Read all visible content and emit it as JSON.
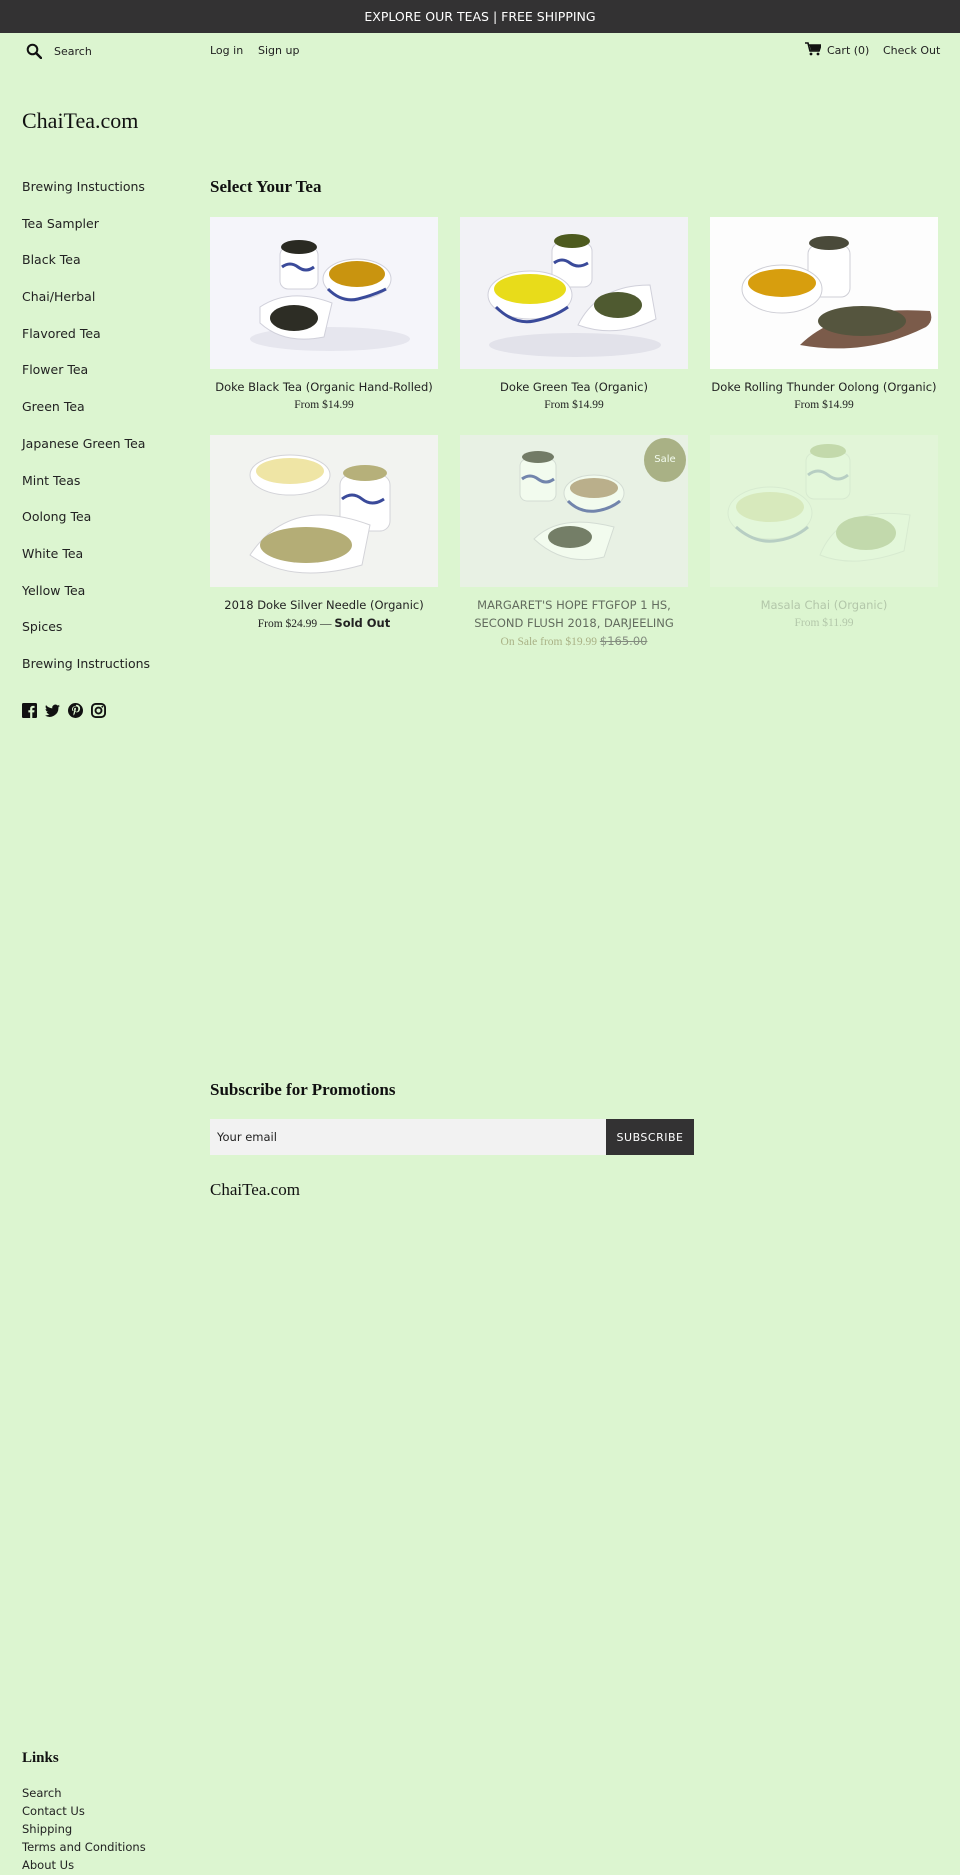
{
  "announcement": "EXPLORE OUR TEAS | FREE SHIPPING",
  "header": {
    "search_placeholder": "Search",
    "login": "Log in",
    "signup": "Sign up",
    "cart": "Cart (0)",
    "checkout": "Check Out"
  },
  "logo": "ChaiTea.com",
  "sidebar": {
    "items": [
      {
        "label": "Brewing Instuctions"
      },
      {
        "label": "Tea Sampler"
      },
      {
        "label": "Black Tea"
      },
      {
        "label": "Chai/Herbal"
      },
      {
        "label": "Flavored Tea"
      },
      {
        "label": "Flower Tea"
      },
      {
        "label": "Green Tea"
      },
      {
        "label": "Japanese Green Tea"
      },
      {
        "label": "Mint Teas"
      },
      {
        "label": "Oolong Tea"
      },
      {
        "label": "White Tea"
      },
      {
        "label": "Yellow Tea"
      },
      {
        "label": "Spices"
      },
      {
        "label": "Brewing Instructions"
      }
    ],
    "social_icons": [
      "facebook-icon",
      "twitter-icon",
      "pinterest-icon",
      "instagram-icon"
    ]
  },
  "collection": {
    "title": "Select Your Tea",
    "products": [
      {
        "name": "Doke Black Tea (Organic Hand-Rolled)",
        "price": "From $14.99"
      },
      {
        "name": "Doke Green Tea (Organic)",
        "price": "From $14.99"
      },
      {
        "name": "Doke Rolling Thunder Oolong (Organic)",
        "price": "From $14.99"
      },
      {
        "name": "2018 Doke Silver Needle (Organic)",
        "price": "From $24.99",
        "sold_out_sep": "—",
        "sold_out": "Sold Out"
      },
      {
        "name": "MARGARET'S HOPE FTGFOP 1 HS, SECOND FLUSH 2018, DARJEELING",
        "sale_price": "On Sale from $19.99",
        "compare_price": "$165.00",
        "badge": "Sale"
      },
      {
        "name": "Masala Chai (Organic)",
        "price": "From $11.99"
      }
    ]
  },
  "newsletter": {
    "title": "Subscribe for Promotions",
    "email_placeholder": "Your email",
    "button": "SUBSCRIBE"
  },
  "footer": {
    "brand": "ChaiTea.com",
    "links_title": "Links",
    "links": [
      {
        "label": "Search"
      },
      {
        "label": "Contact Us"
      },
      {
        "label": "Shipping"
      },
      {
        "label": "Terms and Conditions"
      },
      {
        "label": "About Us"
      }
    ]
  },
  "colors": {
    "background": "#dcf5d0",
    "announcement_bg": "#333233",
    "sale_accent": "#8e8e5e",
    "button_bg": "#333233",
    "input_bg": "#f2f2f2"
  }
}
